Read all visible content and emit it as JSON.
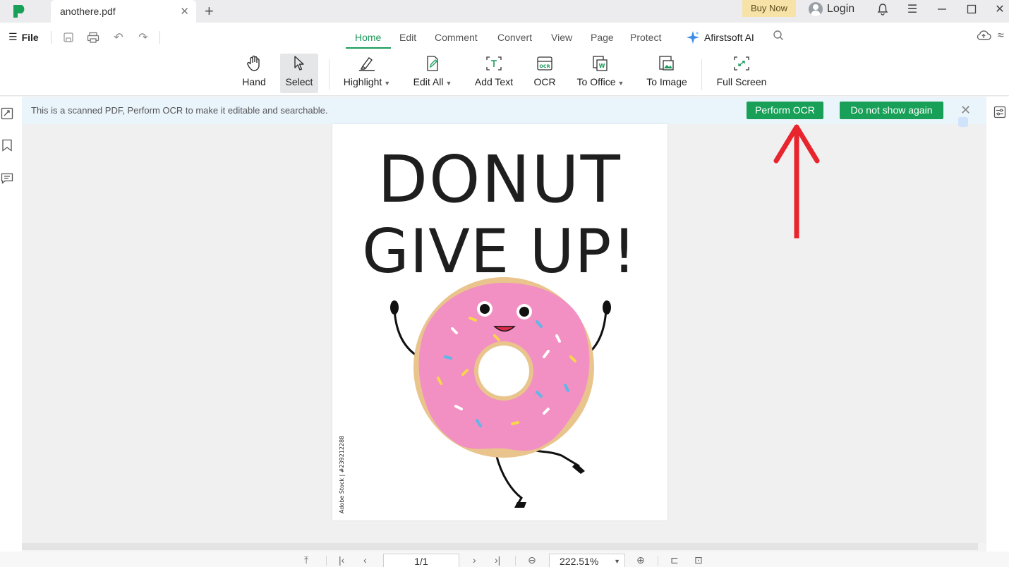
{
  "app": {
    "tab_title": "anothere.pdf",
    "buy_now": "Buy Now",
    "login": "Login",
    "brand_color": "#18a058"
  },
  "menu": {
    "file": "File",
    "tabs": [
      "Home",
      "Edit",
      "Comment",
      "Convert",
      "View",
      "Page",
      "Protect"
    ],
    "active_tab": "Home",
    "ai": "Afirstsoft AI"
  },
  "ribbon": {
    "hand": "Hand",
    "select": "Select",
    "highlight": "Highlight",
    "edit_all": "Edit All",
    "add_text": "Add Text",
    "ocr": "OCR",
    "to_office": "To Office",
    "to_image": "To Image",
    "full_screen": "Full Screen"
  },
  "notice": {
    "text": "This is a scanned PDF, Perform OCR to make it editable and searchable.",
    "perform_ocr": "Perform OCR",
    "dont_show": "Do not show again"
  },
  "document": {
    "line1": "DONUT",
    "line2": "GIVE UP!",
    "watermark": "Adobe Stock | #239212288"
  },
  "bottom": {
    "page": "1/1",
    "zoom": "222.51%"
  },
  "icons": [
    "hand-icon",
    "cursor-icon",
    "highlighter-icon",
    "edit-icon",
    "add-text-icon",
    "ocr-icon",
    "to-office-icon",
    "to-image-icon",
    "full-screen-icon"
  ]
}
